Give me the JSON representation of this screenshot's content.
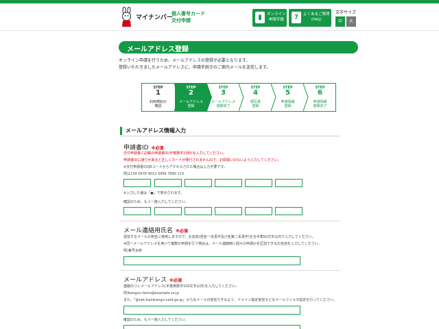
{
  "header": {
    "logo_name": "マイナンバー",
    "logo_sub_line1": "個人番号カード",
    "logo_sub_line2": "交付申請",
    "online_button": {
      "icon": "book-icon",
      "line1": "オンライン",
      "line2": "申請手順"
    },
    "faq_button": {
      "icon": "question-icon",
      "line1": "よくあるご質問",
      "line2": "(FAQ)"
    },
    "font_size_label": "文字サイズ",
    "font_normal": "中",
    "font_large": "大"
  },
  "page_title": "メールアドレス登録",
  "intro": {
    "line1": "オンライン申請を行うため、メールアドレスの登録が必要となります。",
    "line2": "登録いただきましたメールアドレスに、申請手続きのご案内メールを送信します。"
  },
  "steps": [
    {
      "word": "STEP",
      "num": "1",
      "label1": "利用規約の",
      "label2": "確認",
      "state": "done"
    },
    {
      "word": "STEP",
      "num": "2",
      "label1": "メールアドレス",
      "label2": "登録",
      "state": "active"
    },
    {
      "word": "STEP",
      "num": "3",
      "label1": "メールアドレス",
      "label2": "登録完了",
      "state": "todo"
    },
    {
      "word": "STEP",
      "num": "4",
      "label1": "顔写真",
      "label2": "登録",
      "state": "todo"
    },
    {
      "word": "STEP",
      "num": "5",
      "label1": "申請情報",
      "label2": "登録",
      "state": "todo"
    },
    {
      "word": "STEP",
      "num": "6",
      "label1": "申請情報",
      "label2": "登録完了",
      "state": "todo"
    }
  ],
  "section_title": "メールアドレス情報入力",
  "required_label": "※必須",
  "application_id": {
    "title": "申請書ID",
    "red1": "交付申請書に記載の申請書ID(半角数字23桁)を入力してください。",
    "red2": "申請書IDに誤りがあると正しくカードが発行されませんので、お間違いのないよう入力してください。",
    "note1": "※交付申請書のQRコードからアクセスされた場合は入力不要です。",
    "example": "例)1234 5678 9012 3456 7890 123",
    "masked_note": "※入力した値は「●」で表示されます。",
    "confirm_note": "確認のため、もう一度入力してください。"
  },
  "contact_name": {
    "title": "メール連絡用氏名",
    "note1": "送信するメールの宛名に使用しますので、お名前(姓名一本漢字及び名第二本漢字)を全半角50文字以内で入力してください。",
    "note2": "※同一メールアドレスを用いて複数の申請を行う場合は、メール連絡時に個々の申請かを区別できるお名前を入力してください。",
    "example": "例)番号太郎",
    "value": ""
  },
  "email": {
    "title": "メールアドレス",
    "note1": "連絡のつくメールアドレス(半角英数字100文字以内)を入力してください。",
    "example": "例)bangou-tarou@example.co.jp",
    "note2": "また、「@net.kojinbango-card.go.jp」からのメールが受信できるよう、ドメイン指定受信などのメールフィルタ設定を行ってください。",
    "confirm_note": "確認のため、もう一度入力してください。",
    "value": "",
    "confirm_value": ""
  },
  "colors": {
    "brand_green": "#159947",
    "required_red": "#d7000f"
  }
}
